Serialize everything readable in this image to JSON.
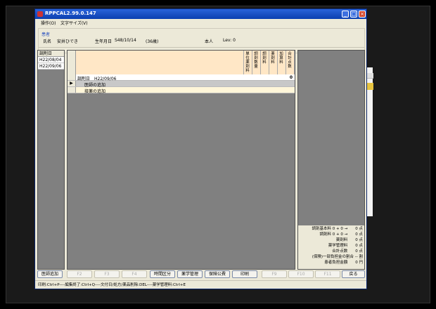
{
  "window": {
    "title": "RPPCAL2.99.0.147",
    "minimize": "_",
    "maximize": "□",
    "close": "×"
  },
  "menu": {
    "items": [
      "操作(O)",
      "文字サイズ(V)"
    ]
  },
  "patient": {
    "caption": "患者",
    "name_label": "氏名",
    "name_value": "安井ひでき",
    "birth_label": "生年月日",
    "birth_value": "S48/10/14",
    "age": "(36歳)",
    "self_label": "本人",
    "lev": "Lev: 0"
  },
  "datelist": {
    "header": "調剤日",
    "rows": [
      "H22/08/04",
      "H22/09/06"
    ]
  },
  "grid": {
    "columns": [
      "単位薬剤料",
      "調剤数量",
      "調剤料",
      "薬剤料",
      "加算料",
      "合計点数"
    ],
    "rows": [
      {
        "label": "調剤日　H22/09/06",
        "value": "0"
      },
      {
        "label": "医師の追加",
        "value": ""
      },
      {
        "label": "接薬の追加",
        "value": ""
      }
    ],
    "selected_marker": "▶"
  },
  "summary": {
    "lines": [
      "調剤基本料 0 + 0 →　　0 点",
      "調剤料 0 + 0 →　　0 点",
      "薬剤料　　0 点",
      "薬学管理料　　0 点",
      "合計点数　　0 点",
      "(保険)一部負担金の割合 -- 割",
      "患者負担金額　　0 円"
    ]
  },
  "buttons": {
    "doctor_add": "医師追加",
    "f2": "F2",
    "f3": "F3",
    "f4": "F4",
    "time_category": "時間区分",
    "pharmacy_mgmt": "薬学管理",
    "insurance": "保険公費",
    "print": "印刷",
    "f9": "F9",
    "f10": "F10",
    "f11": "F11",
    "back": "戻る"
  },
  "statusbar": {
    "text": "印刷:Ctrl+P----編集終了:Ctrl+Q----文付日/処方/薬品削除:DEL----薬学管理料:Ctrl+E"
  },
  "colors": {
    "title_bar": "#0b3fb0",
    "grid_header": "#ffe7c6",
    "grid_bg": "#808080",
    "window_bg": "#ece9d8"
  }
}
